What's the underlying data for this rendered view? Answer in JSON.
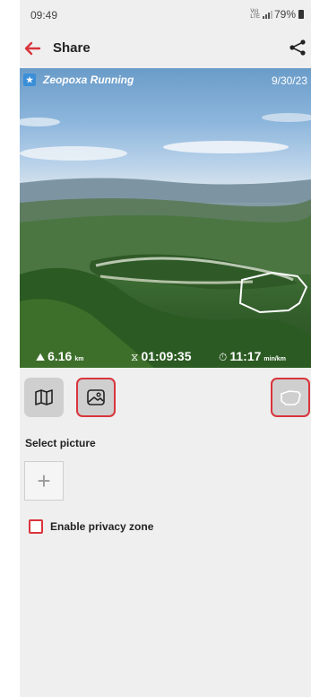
{
  "status_bar": {
    "time": "09:49",
    "network": "VoLTE",
    "battery": "79%"
  },
  "app_bar": {
    "title": "Share",
    "back_icon": "back-arrow-icon",
    "share_icon": "share-icon"
  },
  "photo": {
    "brand": "Zeopoxa Running",
    "date": "9/30/23",
    "stats": {
      "distance": {
        "value": "6.16",
        "unit": "km"
      },
      "duration": {
        "value": "01:09:35"
      },
      "pace": {
        "value": "11:17",
        "unit": "min/km"
      }
    }
  },
  "tools": [
    {
      "name": "map-mode",
      "icon": "map-icon",
      "selected": false
    },
    {
      "name": "photo-mode",
      "icon": "image-icon",
      "selected": true
    },
    {
      "name": "route-only",
      "icon": "route-shape-icon",
      "selected": true
    }
  ],
  "select_picture_label": "Select picture",
  "add_picture": "+",
  "privacy_label": "Enable privacy zone",
  "colors": {
    "accent": "#d9343c",
    "background": "#efefef"
  }
}
